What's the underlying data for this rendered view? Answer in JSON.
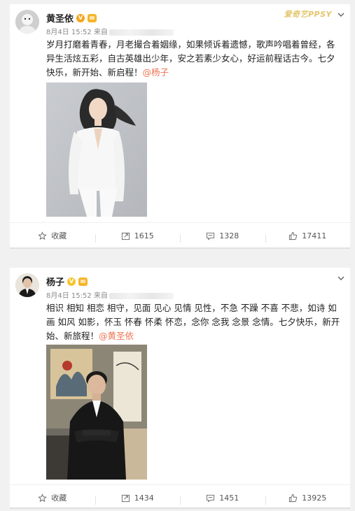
{
  "posts": [
    {
      "author": "黄圣依",
      "verified": "V",
      "watermark": "爱奇艺PPSY",
      "meta": "8月4日 15:52 来自",
      "text": "岁月打磨着青春，月老撮合着姻缘，如果倾诉着遗憾，歌声吟唱着曾经，各异生活炫五彩，自古英雄出少年，安之若素少女心，好运前程话古今。七夕快乐，新开始、新启程！",
      "mention": "@杨子",
      "actions": {
        "favorite": "收藏",
        "repost": "1615",
        "comment": "1328",
        "like": "17411"
      }
    },
    {
      "author": "杨子",
      "verified": "V",
      "meta": "8月4日 15:52 来自",
      "text": "相识 相知 相恋 相守，见面 见心 见情 见性，不急 不躁 不喜 不悲，如诗 如画 如风 如影，怀玉 怀春 怀柔 怀恋，念你 念我 念景 念情。七夕快乐，新开始、新旅程！",
      "mention": "@黄圣依",
      "actions": {
        "favorite": "收藏",
        "repost": "1434",
        "comment": "1451",
        "like": "13925"
      }
    }
  ],
  "colors": {
    "mention": "#eb7350",
    "badge_orange": "#f3a51c",
    "badge_yellow": "#f7c52c"
  }
}
